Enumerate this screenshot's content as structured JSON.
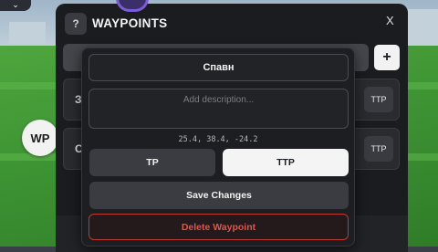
{
  "hud": {
    "corner_icon": "chevron-down-icon",
    "corner_glyph": "⌄"
  },
  "wp_button": {
    "label": "WP"
  },
  "window": {
    "title": "WAYPOINTS",
    "help_label": "?",
    "close_label": "X",
    "add_label": "+",
    "rows": [
      {
        "name": "З",
        "ttp_label": "TTP"
      },
      {
        "name": "С",
        "ttp_label": "TTP"
      }
    ]
  },
  "popup": {
    "name_value": "Спавн",
    "description_placeholder": "Add description...",
    "coordinates": "25.4, 38.4, -24.2",
    "tp_label": "TP",
    "ttp_label": "TTP",
    "save_label": "Save Changes",
    "delete_label": "Delete Waypoint"
  },
  "colors": {
    "accent_delete": "#e4524a",
    "ttp_selected_bg": "#f4f4f4",
    "panel_bg": "#1b1c1f"
  }
}
